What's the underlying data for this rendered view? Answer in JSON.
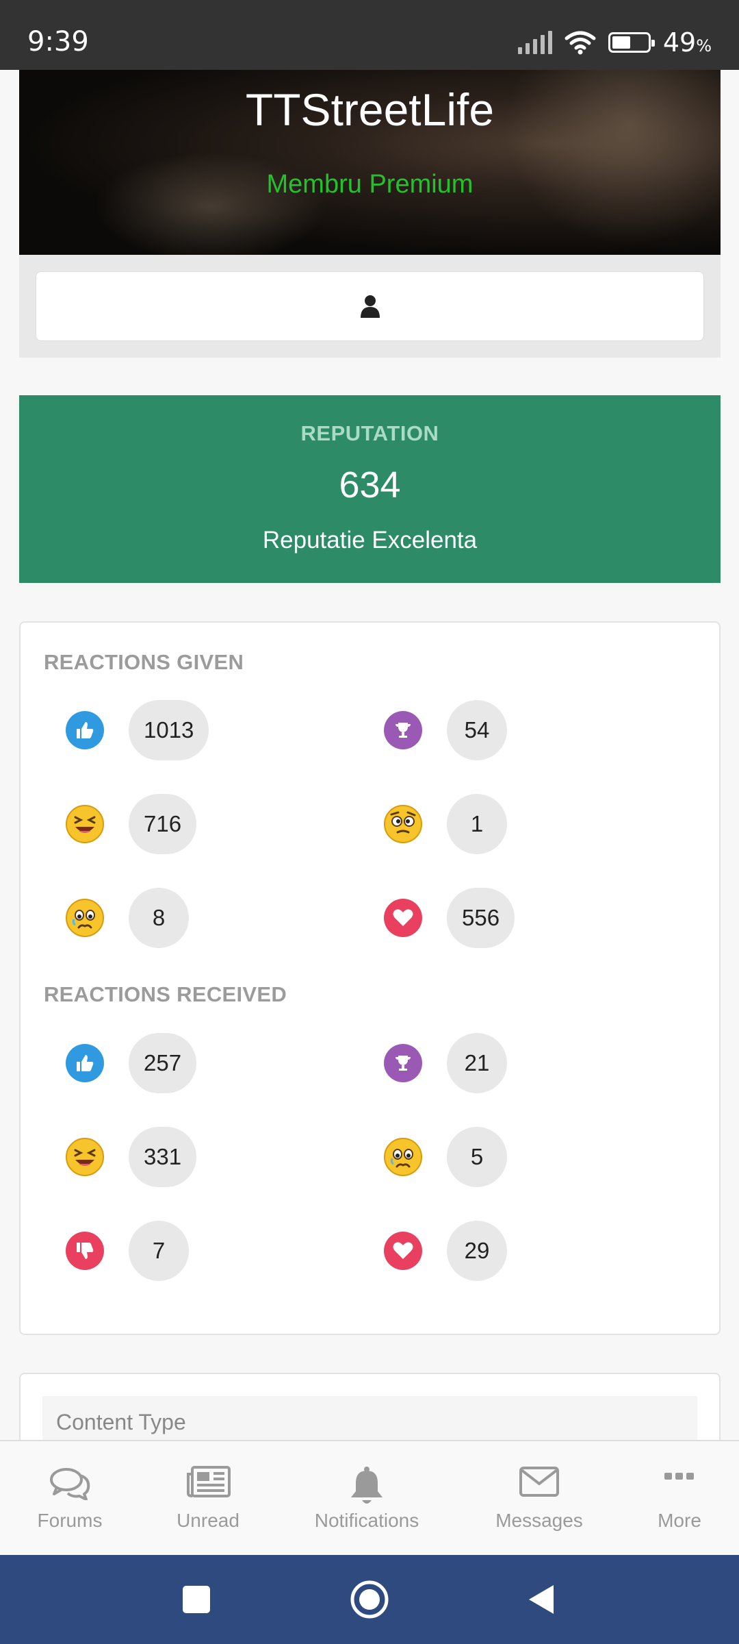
{
  "status_bar": {
    "time": "9:39",
    "battery_value": "49",
    "battery_unit": "%"
  },
  "profile": {
    "username": "TTStreetLife",
    "user_title": "Membru Premium",
    "user_title_color": "#22c32a"
  },
  "reputation": {
    "label": "REPUTATION",
    "value": "634",
    "description": "Reputatie Excelenta",
    "background": "#2e8b68"
  },
  "reactions_given": {
    "title": "REACTIONS GIVEN",
    "items": [
      {
        "icon": "like-icon",
        "count": "1013"
      },
      {
        "icon": "trophy-icon",
        "count": "54"
      },
      {
        "icon": "laughing-emoji-icon",
        "count": "716"
      },
      {
        "icon": "confused-emoji-icon",
        "count": "1"
      },
      {
        "icon": "sad-emoji-icon",
        "count": "8"
      },
      {
        "icon": "heart-icon",
        "count": "556"
      }
    ]
  },
  "reactions_received": {
    "title": "REACTIONS RECEIVED",
    "items": [
      {
        "icon": "like-icon",
        "count": "257"
      },
      {
        "icon": "trophy-icon",
        "count": "21"
      },
      {
        "icon": "laughing-emoji-icon",
        "count": "331"
      },
      {
        "icon": "sad-emoji-icon",
        "count": "5"
      },
      {
        "icon": "dislike-icon",
        "count": "7"
      },
      {
        "icon": "heart-icon",
        "count": "29"
      }
    ]
  },
  "content_filter": {
    "label": "Content Type"
  },
  "bottom_nav": [
    {
      "label": "Forums",
      "icon": "chat-bubbles-icon"
    },
    {
      "label": "Unread",
      "icon": "newspaper-icon"
    },
    {
      "label": "Notifications",
      "icon": "bell-icon"
    },
    {
      "label": "Messages",
      "icon": "envelope-icon"
    },
    {
      "label": "More",
      "icon": "more-dots-icon"
    }
  ]
}
